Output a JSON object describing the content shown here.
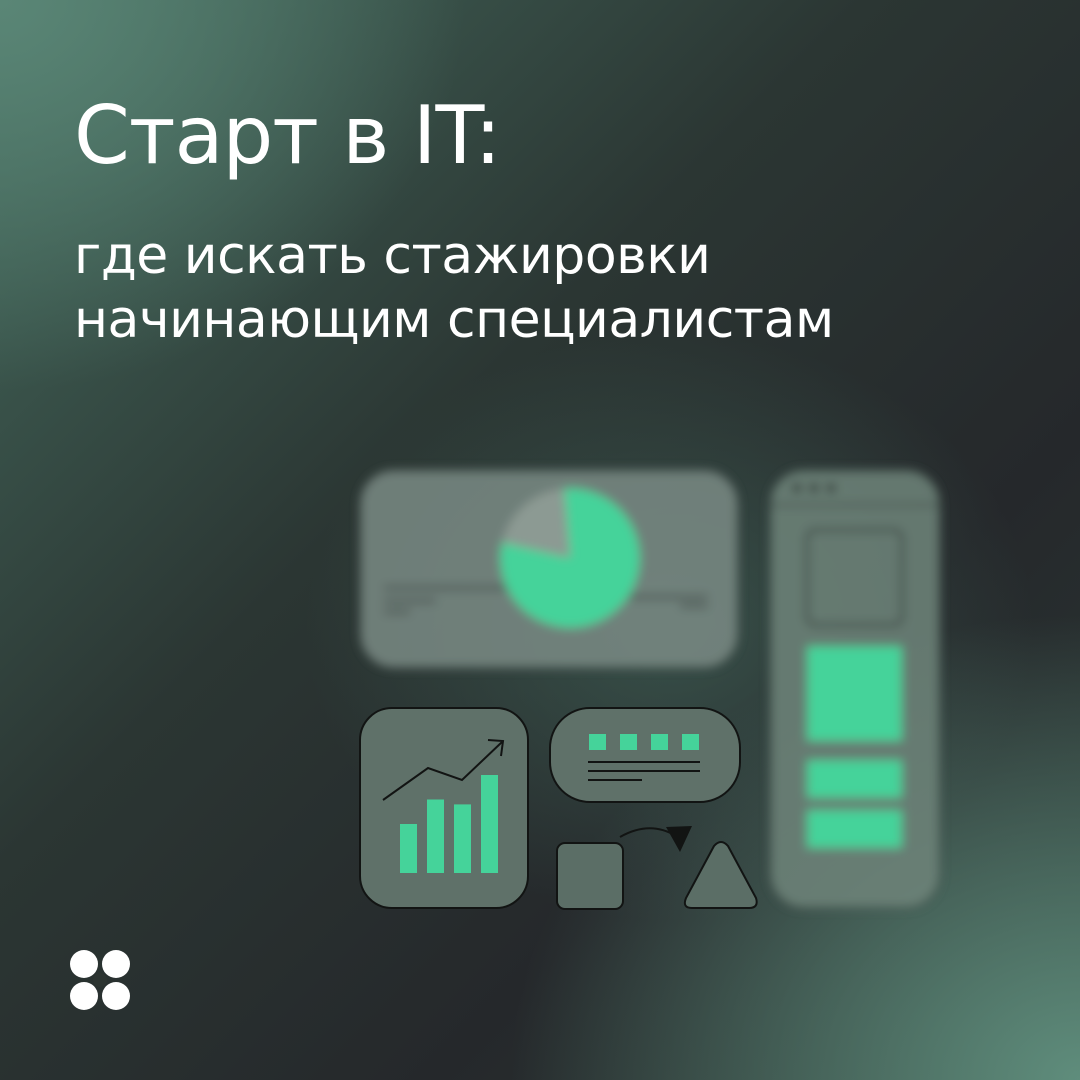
{
  "heading": {
    "title": "Старт в IT:",
    "subtitle_line1": "где искать стажировки",
    "subtitle_line2": "начинающим специалистам"
  },
  "colors": {
    "accent": "#45d39a",
    "text": "#ffffff",
    "card": "#6b7e76"
  },
  "illustration": {
    "pie_chart_share": 0.8,
    "bar_chart_values": [
      5,
      7.5,
      7,
      10
    ],
    "list_items_count": 4
  },
  "logo": {
    "icon": "four-circle-logo-icon"
  }
}
